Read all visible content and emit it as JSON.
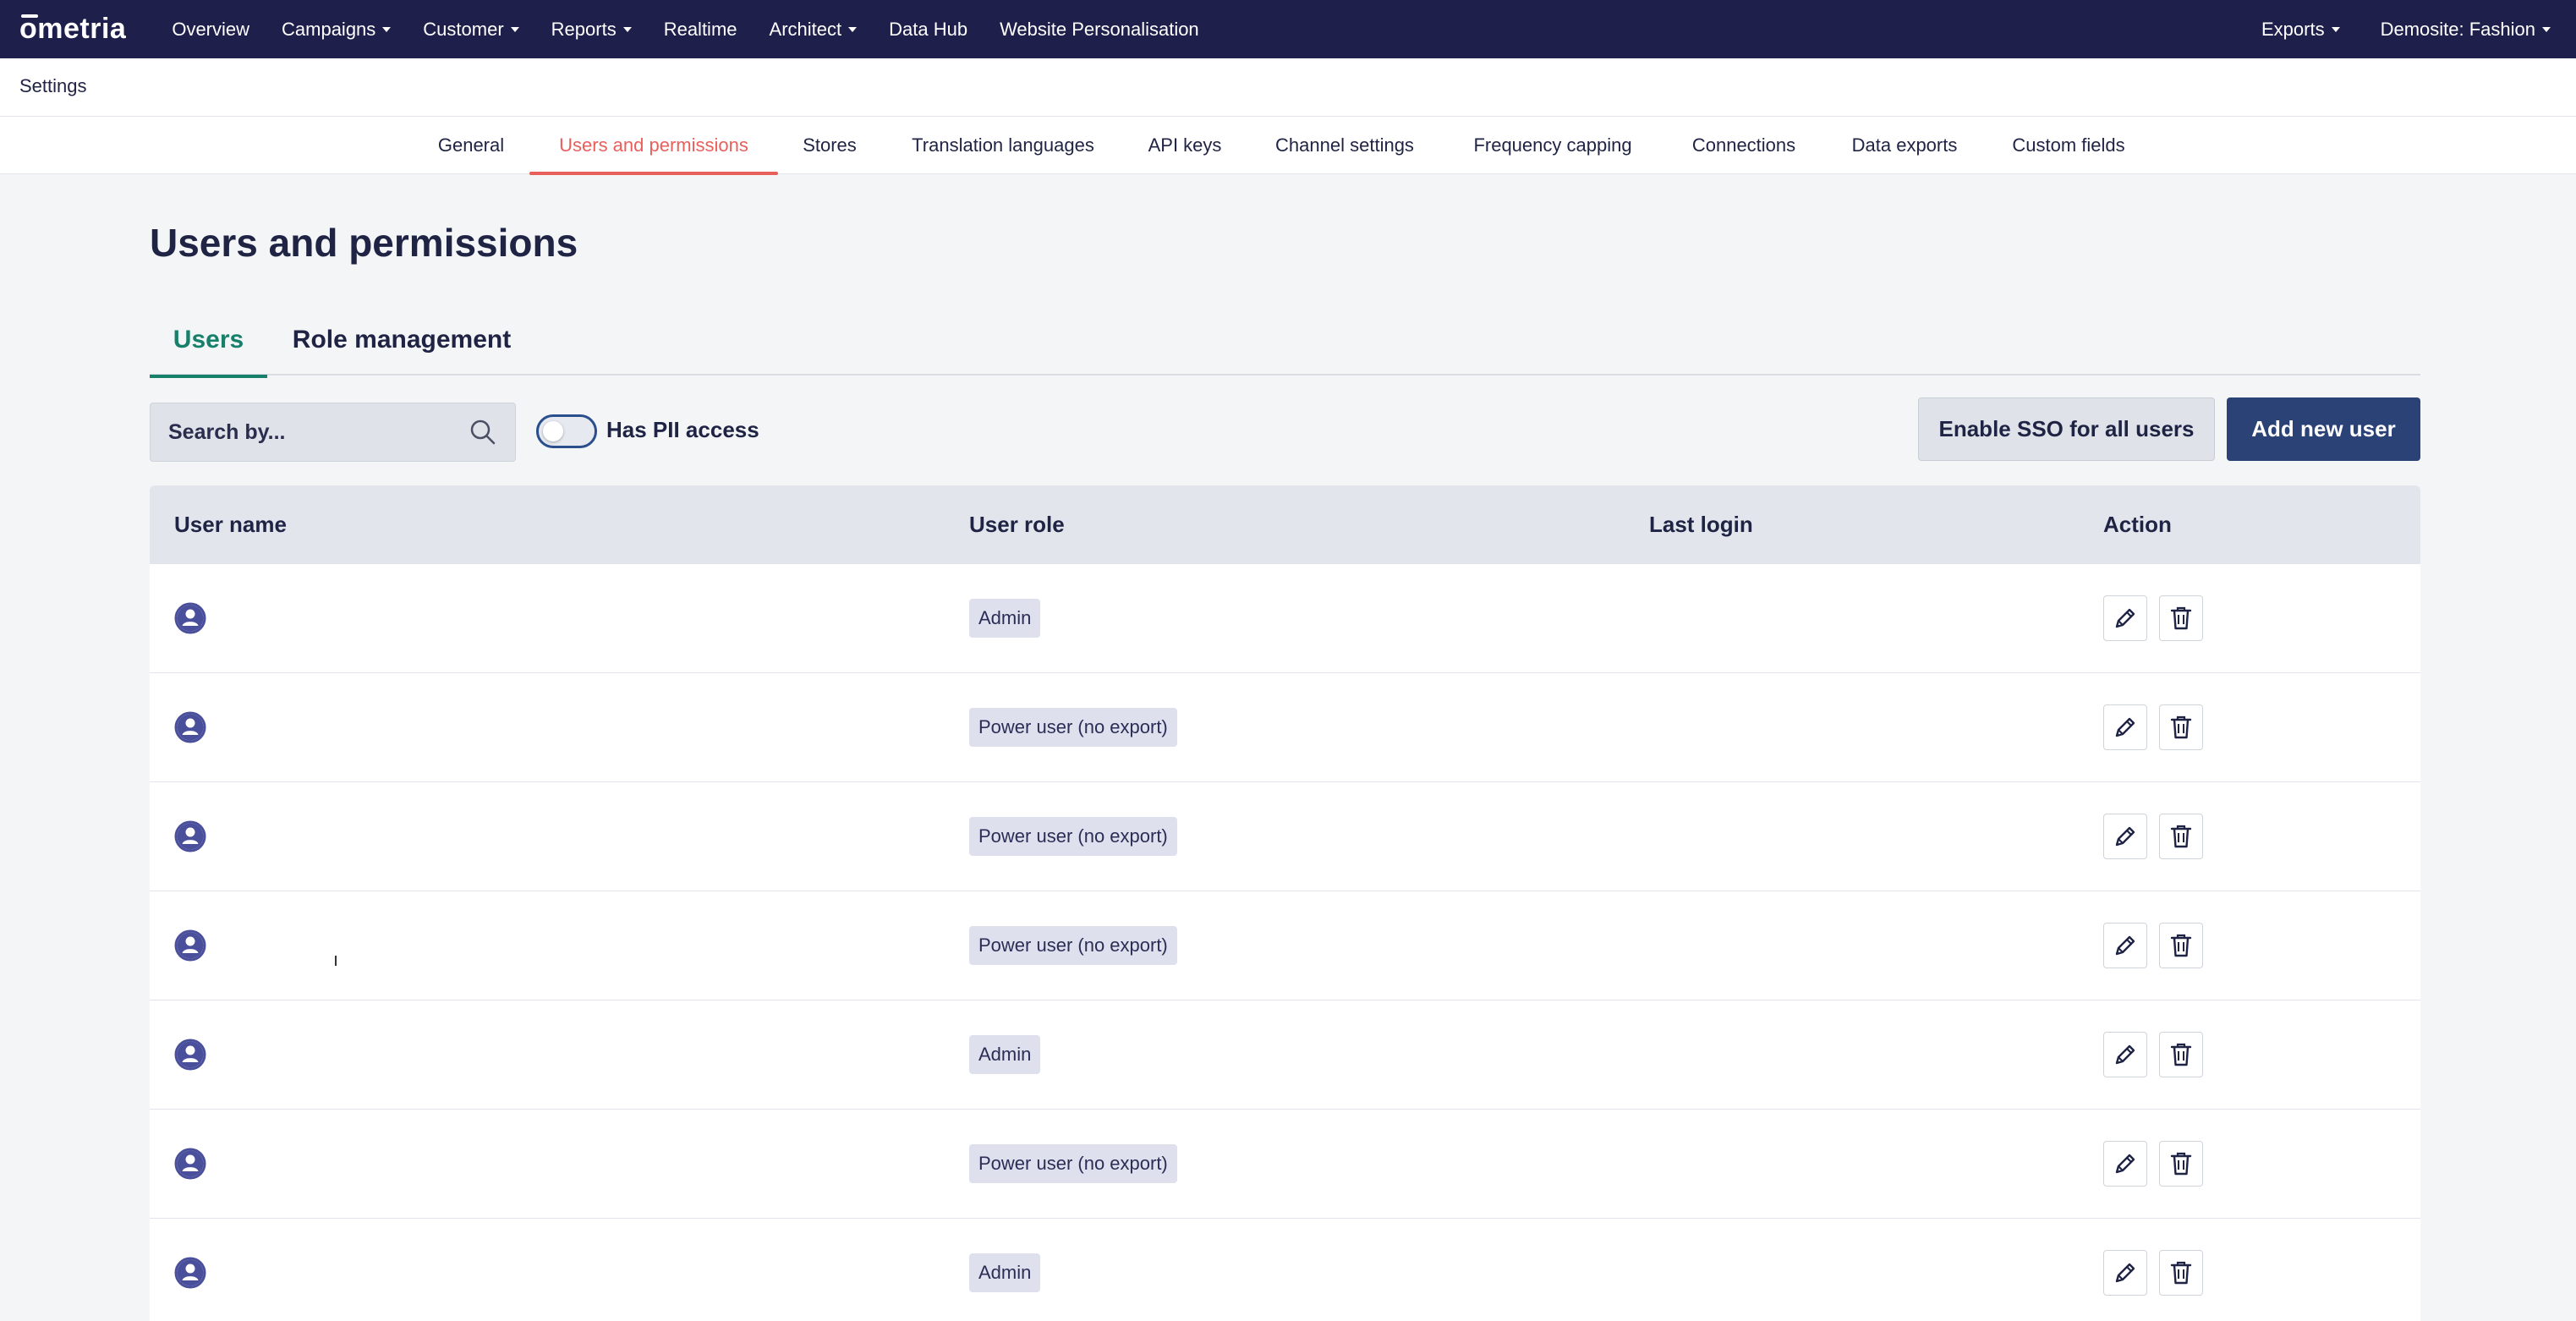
{
  "topnav": {
    "logo": "ometria",
    "items": [
      {
        "label": "Overview",
        "dropdown": false
      },
      {
        "label": "Campaigns",
        "dropdown": true
      },
      {
        "label": "Customer",
        "dropdown": true
      },
      {
        "label": "Reports",
        "dropdown": true
      },
      {
        "label": "Realtime",
        "dropdown": false
      },
      {
        "label": "Architect",
        "dropdown": true
      },
      {
        "label": "Data Hub",
        "dropdown": false
      },
      {
        "label": "Website Personalisation",
        "dropdown": false
      }
    ],
    "right_items": [
      {
        "label": "Exports",
        "dropdown": true
      },
      {
        "label": "Demosite: Fashion",
        "dropdown": true
      }
    ],
    "background": "#1e1f4b"
  },
  "settings": {
    "label": "Settings"
  },
  "subnav": {
    "items": [
      "General",
      "Users and permissions",
      "Stores",
      "Translation languages",
      "API keys",
      "Channel settings",
      "Frequency capping",
      "Connections",
      "Data exports",
      "Custom fields"
    ],
    "active": "Users and permissions",
    "active_color": "#e8605c"
  },
  "page": {
    "title": "Users and permissions",
    "tabs": [
      "Users",
      "Role management"
    ],
    "active_tab": "Users",
    "active_tab_color": "#16806a"
  },
  "toolbar": {
    "search_placeholder": "Search by...",
    "search_value": "",
    "pii_toggle_label": "Has PII access",
    "pii_toggle_on": false,
    "sso_button": "Enable SSO for all users",
    "add_button": "Add new user",
    "add_button_color": "#2b4277"
  },
  "table": {
    "columns": [
      "User name",
      "User role",
      "Last login",
      "Action"
    ],
    "rows": [
      {
        "role": "Admin"
      },
      {
        "role": "Power user (no export)"
      },
      {
        "role": "Power user (no export)"
      },
      {
        "role": "Power user (no export)"
      },
      {
        "role": "Admin"
      },
      {
        "role": "Power user (no export)"
      },
      {
        "role": "Admin"
      }
    ],
    "avatar_color": "#4a4f9c"
  }
}
